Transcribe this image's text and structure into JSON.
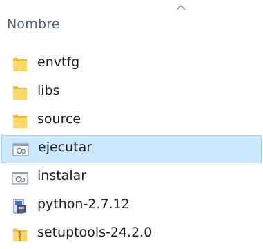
{
  "header": {
    "column_name": "Nombre",
    "sort_direction": "ascending"
  },
  "files": [
    {
      "name": "envtfg",
      "type": "folder",
      "icon": "folder-icon"
    },
    {
      "name": "libs",
      "type": "folder",
      "icon": "folder-icon"
    },
    {
      "name": "source",
      "type": "folder",
      "icon": "folder-icon"
    },
    {
      "name": "ejecutar",
      "type": "batch",
      "icon": "batch-file-icon",
      "selected": true
    },
    {
      "name": "instalar",
      "type": "batch",
      "icon": "batch-file-icon"
    },
    {
      "name": "python-2.7.12",
      "type": "installer",
      "icon": "installer-icon"
    },
    {
      "name": "setuptools-24.2.0",
      "type": "archive",
      "icon": "zip-archive-icon"
    }
  ],
  "colors": {
    "header_text": "#4c607a",
    "selection_bg": "#cce8ff",
    "selection_border": "#99d1ff",
    "folder": "#ffd766"
  }
}
